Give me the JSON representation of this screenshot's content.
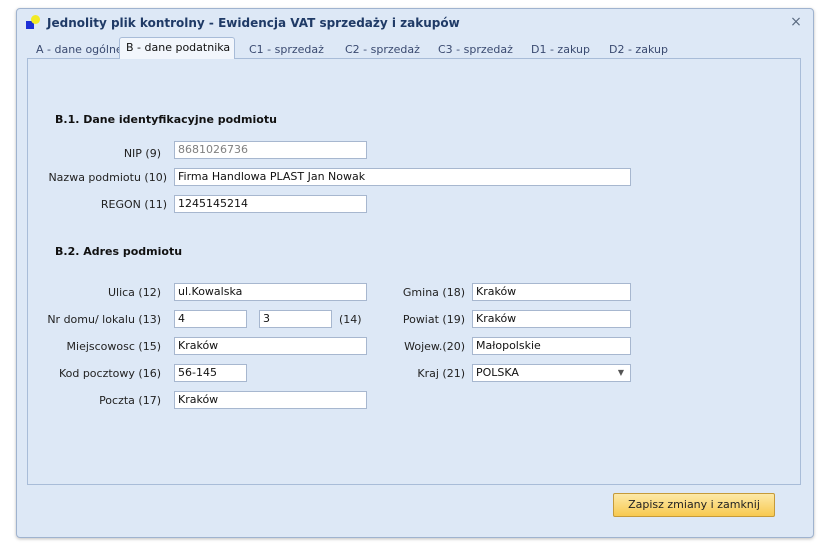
{
  "window": {
    "title": "Jednolity plik kontrolny - Ewidencja VAT sprzedaży i zakupów",
    "close_glyph": "×"
  },
  "tabs": [
    {
      "label": "A - dane ogólne"
    },
    {
      "label": "B - dane podatnika",
      "active": true
    },
    {
      "label": "C1 - sprzedaż"
    },
    {
      "label": "C2 - sprzedaż"
    },
    {
      "label": "C3 - sprzedaż"
    },
    {
      "label": "D1 - zakup"
    },
    {
      "label": "D2 - zakup"
    }
  ],
  "section_b1": {
    "title": "B.1. Dane identyfikacyjne podmiotu",
    "nip_label": "NIP (9)",
    "nip_value": "8681026736",
    "name_label": "Nazwa podmiotu (10)",
    "name_value": "Firma Handlowa PLAST Jan Nowak",
    "regon_label": "REGON (11)",
    "regon_value": "1245145214"
  },
  "section_b2": {
    "title": "B.2. Adres podmiotu",
    "street_label": "Ulica (12)",
    "street_value": "ul.Kowalska",
    "house_label": "Nr domu/ lokalu (13)",
    "house_value": "4",
    "flat_value": "3",
    "flat_label": "(14)",
    "city_label": "Miejscowosc (15)",
    "city_value": "Kraków",
    "postcode_label": "Kod pocztowy (16)",
    "postcode_value": "56-145",
    "post_label": "Poczta (17)",
    "post_value": "Kraków",
    "commune_label": "Gmina (18)",
    "commune_value": "Kraków",
    "county_label": "Powiat (19)",
    "county_value": "Kraków",
    "voivodeship_label": "Wojew.(20)",
    "voivodeship_value": "Małopolskie",
    "country_label": "Kraj (21)",
    "country_value": "POLSKA"
  },
  "footer": {
    "save_label": "Zapisz zmiany i zamknij"
  },
  "colors": {
    "window_bg": "#dde8f6",
    "title_text": "#1f3a66",
    "button_gradient_top": "#fde9a8",
    "button_gradient_bottom": "#f7c950"
  },
  "icons": {
    "app": "app-logo-icon",
    "close": "close-icon",
    "dropdown": "chevron-down-icon"
  }
}
